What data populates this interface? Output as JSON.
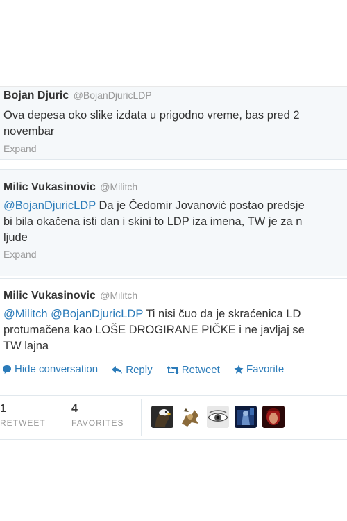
{
  "tweets": [
    {
      "name": "Bojan Djuric",
      "handle": "@BojanDjuricLDP",
      "line1": "Ova depesa oko slike izdata u prigodno vreme, bas pred 2",
      "line2": "novembar",
      "expand": "Expand"
    },
    {
      "name": "Milic Vukasinovic",
      "handle": "@Militch",
      "mention": "@BojanDjuricLDP",
      "line1_rest": " Da je Čedomir Jovanović postao predsje",
      "line2": "bi bila okačena isti dan i skini to LDP iza imena, TW je za n",
      "line3": "ljude",
      "expand": "Expand"
    },
    {
      "name": "Milic Vukasinovic",
      "handle": "@Militch",
      "mention1": "@Militch",
      "mention2": "@BojanDjuricLDP",
      "line1_rest": " Ti nisi čuo da je skraćenica LD",
      "line2": "protumačena kao LOŠE DROGIRANE PIČKE i ne javljaj se",
      "line3": "TW lajna"
    }
  ],
  "actions": {
    "hide": "Hide conversation",
    "reply": "Reply",
    "retweet": "Retweet",
    "favorite": "Favorite"
  },
  "stats": {
    "retweets_count": "1",
    "retweets_label": "RETWEET",
    "favorites_count": "4",
    "favorites_label": "FAVORITES"
  },
  "colors": {
    "link": "#2b7bb9",
    "muted": "#999999",
    "text": "#333333"
  }
}
